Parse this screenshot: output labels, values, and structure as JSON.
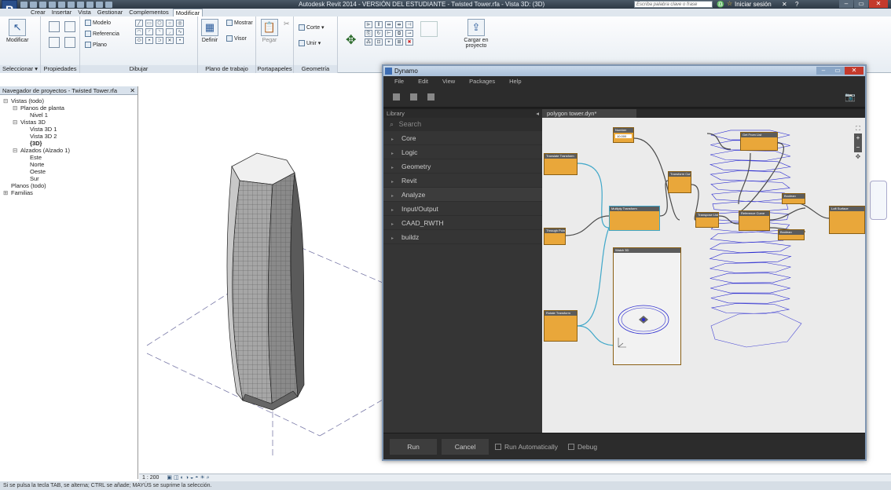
{
  "revit": {
    "title": "Autodesk Revit 2014 - VERSIÓN DEL ESTUDIANTE -  Twisted Tower.rfa - Vista 3D: (3D)",
    "search_placeholder": "Escriba palabra clave o frase",
    "login": "Iniciar sesión",
    "tabs": [
      "Crear",
      "Insertar",
      "Vista",
      "Gestionar",
      "Complementos",
      "Modificar"
    ],
    "active_tab": "Modificar",
    "ribbon": {
      "modify_btn": "Modificar",
      "select_label": "Seleccionar ▾",
      "props_label": "Propiedades",
      "draw_label": "Dibujar",
      "workplane_label": "Plano de trabajo",
      "clipboard_label": "Portapapeles",
      "geometry_label": "Geometría",
      "modelo": "Modelo",
      "referencia": "Referencia",
      "plano": "Plano",
      "mostrar": "Mostrar",
      "definir": "Definir",
      "visor": "Visor",
      "pegar": "Pegar",
      "corte": "Corte ▾",
      "unir": "Unir ▾",
      "cargar": "Cargar en proyecto"
    },
    "browser": {
      "title": "Navegador de proyectos - Twisted Tower.rfa",
      "items": [
        {
          "label": "Vistas (todo)",
          "indent": 0,
          "exp": "⊟"
        },
        {
          "label": "Planos de planta",
          "indent": 1,
          "exp": "⊟"
        },
        {
          "label": "Nivel 1",
          "indent": 2,
          "exp": ""
        },
        {
          "label": "Vistas 3D",
          "indent": 1,
          "exp": "⊟"
        },
        {
          "label": "Vista 3D 1",
          "indent": 2,
          "exp": ""
        },
        {
          "label": "Vista 3D 2",
          "indent": 2,
          "exp": ""
        },
        {
          "label": "{3D}",
          "indent": 2,
          "exp": "",
          "bold": true
        },
        {
          "label": "Alzados (Alzado 1)",
          "indent": 1,
          "exp": "⊟"
        },
        {
          "label": "Este",
          "indent": 2,
          "exp": ""
        },
        {
          "label": "Norte",
          "indent": 2,
          "exp": ""
        },
        {
          "label": "Oeste",
          "indent": 2,
          "exp": ""
        },
        {
          "label": "Sur",
          "indent": 2,
          "exp": ""
        },
        {
          "label": "Planos (todo)",
          "indent": 0,
          "exp": ""
        },
        {
          "label": "Familias",
          "indent": 0,
          "exp": "⊞"
        }
      ]
    },
    "scale": "1 : 200",
    "status": "Si se pulsa la tecla TAB, se alterna; CTRL se añade; MAYÚS se suprime la selección."
  },
  "dynamo": {
    "title": "Dynamo",
    "menu": [
      "File",
      "Edit",
      "View",
      "Packages",
      "Help"
    ],
    "library_header": "Library",
    "search_placeholder": "Search",
    "library_items": [
      "Core",
      "Logic",
      "Geometry",
      "Revit",
      "Analyze",
      "Input/Output",
      "CAAD_RWTH",
      "buildz"
    ],
    "active_library_item": "Analyze",
    "canvas_tab": "polygon tower.dyn*",
    "run_label": "Run",
    "cancel_label": "Cancel",
    "run_auto_label": "Run Automatically",
    "debug_label": "Debug",
    "nodes": {
      "number": "Number",
      "number_value": "10.000",
      "translate": "Translate Transform",
      "through_points": "Through Points",
      "multiply": "Multiply Transform",
      "transform_curve": "Transform Curve",
      "get_from_list": "Get From List",
      "boolean1": "Boolean",
      "boolean2": "Boolean",
      "transpose": "Transpose Lists",
      "reference_curve": "Reference Curve",
      "loft_surface": "Loft Surface",
      "watch3d": "Watch 3D",
      "rotate": "Rotate Transform"
    }
  },
  "colors": {
    "node": "#e9a73a",
    "wire": "#4a4a4a",
    "wire_blue": "#3fa7c9",
    "preview": "#2a2ad0"
  }
}
